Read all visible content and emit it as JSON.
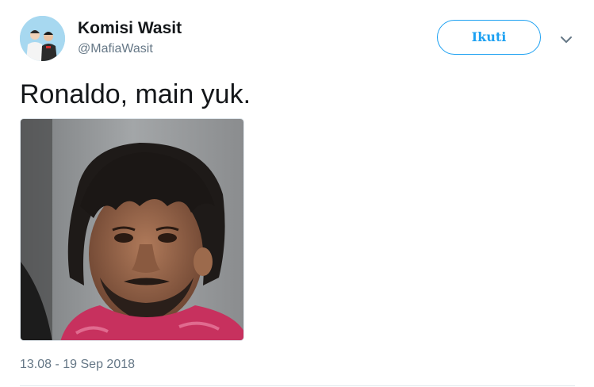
{
  "user": {
    "display_name": "Komisi Wasit",
    "handle": "@MafiaWasit",
    "avatar_icon": "avatar-referee-icon"
  },
  "follow_button": {
    "label": "Ikuti"
  },
  "menu": {
    "icon": "chevron-down-icon"
  },
  "tweet": {
    "text": "Ronaldo, main yuk.",
    "timestamp": "13.08 - 19 Sep 2018"
  },
  "colors": {
    "accent": "#1da1f2",
    "text": "#14171a",
    "secondary": "#657786",
    "border": "#e1e8ed"
  }
}
